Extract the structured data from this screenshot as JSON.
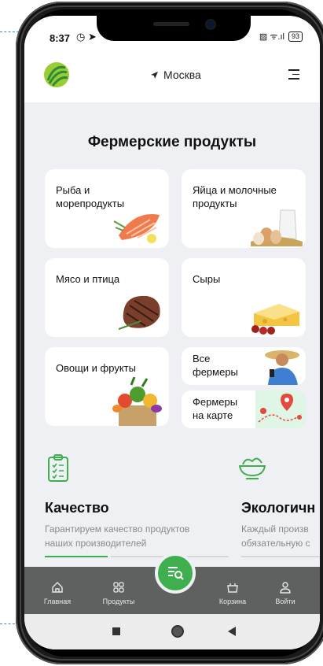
{
  "status_bar": {
    "time": "8:37",
    "icons": "◷ ➤",
    "signal": "▨ ᯤ.ıl",
    "battery": "93"
  },
  "header": {
    "location": "Москва"
  },
  "page": {
    "title": "Фермерские продукты"
  },
  "categories": [
    {
      "label": "Рыба и морепродукты"
    },
    {
      "label": "Яйца и молочные продукты"
    },
    {
      "label": "Мясо и птица"
    },
    {
      "label": "Сыры"
    },
    {
      "label": "Овощи и фрукты"
    },
    {
      "label": "Все фермеры"
    },
    {
      "label": "Фермеры на карте"
    }
  ],
  "features": [
    {
      "title": "Качество",
      "desc_line1": "Гарантируем качество продуктов",
      "desc_line2": "наших производителей"
    },
    {
      "title": "Экологичн",
      "desc_line1": "Каждый произв",
      "desc_line2": "обязательную с"
    }
  ],
  "bottom_nav": {
    "home": "Главная",
    "products": "Продукты",
    "cart": "Корзина",
    "login": "Войти"
  },
  "colors": {
    "accent": "#3fae4f",
    "nav_bg": "#5f6160",
    "screen_bg": "#eef0f3"
  }
}
